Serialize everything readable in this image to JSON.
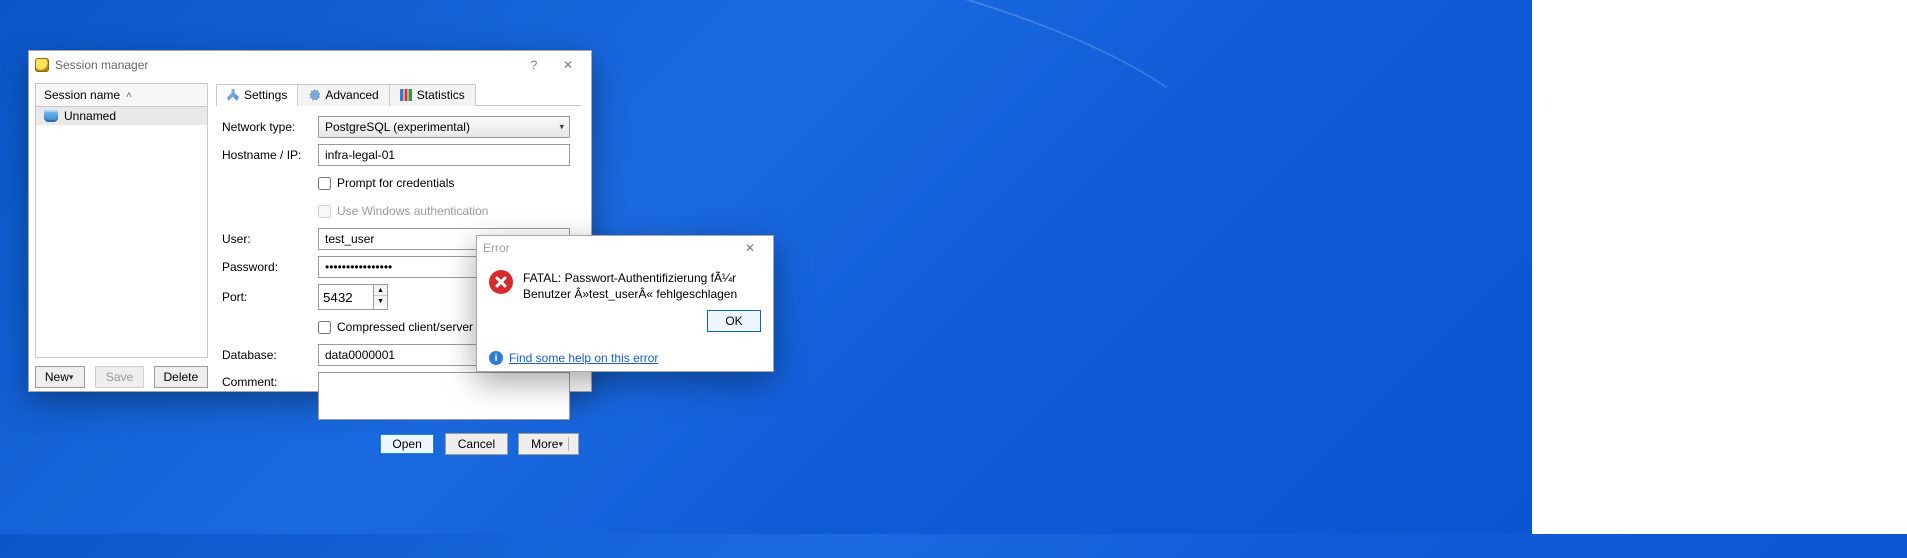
{
  "session_window": {
    "title": "Session manager",
    "tree_header": "Session name",
    "tree_item": "Unnamed",
    "tabs": {
      "settings": "Settings",
      "advanced": "Advanced",
      "statistics": "Statistics"
    },
    "labels": {
      "network_type": "Network type:",
      "hostname": "Hostname / IP:",
      "prompt": "Prompt for credentials",
      "winauth": "Use Windows authentication",
      "user": "User:",
      "password": "Password:",
      "port": "Port:",
      "compressed": "Compressed client/server protocol",
      "database": "Database:",
      "comment": "Comment:"
    },
    "values": {
      "network_type": "PostgreSQL (experimental)",
      "hostname": "infra-legal-01",
      "user": "test_user",
      "password": "••••••••••••••••",
      "port": "5432",
      "database": "data0000001",
      "comment": ""
    },
    "buttons": {
      "new": "New",
      "save": "Save",
      "delete": "Delete",
      "open": "Open",
      "cancel": "Cancel",
      "more": "More"
    }
  },
  "error_window": {
    "title": "Error",
    "message": "FATAL:  Passwort-Authentifizierung fÃ¼r Benutzer Â»test_userÂ« fehlgeschlagen",
    "ok": "OK",
    "help": "Find some help on this error"
  }
}
